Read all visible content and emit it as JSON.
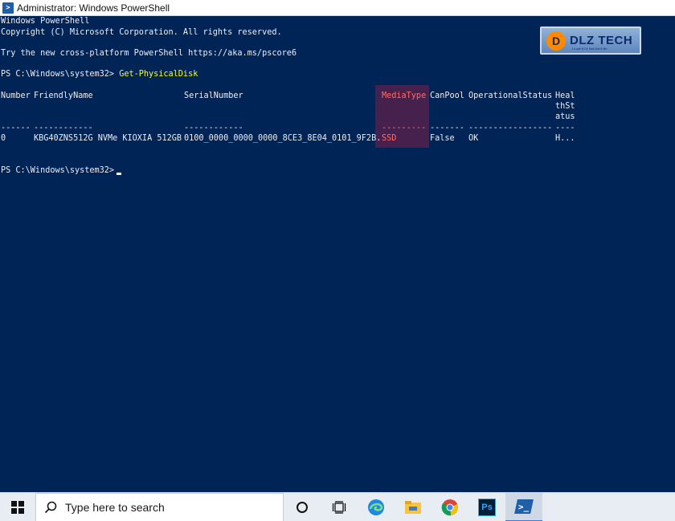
{
  "window": {
    "title": "Administrator: Windows PowerShell",
    "icon": "powershell-icon"
  },
  "console": {
    "banner_1": "Windows PowerShell",
    "banner_2": "Copyright (C) Microsoft Corporation. All rights reserved.",
    "banner_3": "Try the new cross-platform PowerShell https://aka.ms/pscore6",
    "prompt_1": "PS C:\\Windows\\system32> ",
    "command_1": "Get-PhysicalDisk",
    "prompt_2": "PS C:\\Windows\\system32> ",
    "table": {
      "headers": {
        "number": "Number",
        "friendly_name": "FriendlyName",
        "serial_number": "SerialNumber",
        "media_type": "MediaType",
        "can_pool": "CanPool",
        "operational_status": "OperationalStatus",
        "health_1": "Heal",
        "health_2": "thSt",
        "health_3": "atus"
      },
      "underlines": {
        "number": "------",
        "friendly_name": "------------",
        "serial_number": "------------",
        "media_type": "---------",
        "can_pool": "-------",
        "operational_status": "-----------------",
        "health": "----"
      },
      "row": {
        "number": "0",
        "friendly_name": "KBG40ZNS512G NVMe KIOXIA 512GB",
        "serial_number": "0100_0000_0000_0000_8CE3_8E04_0101_9F2B.",
        "media_type": "SSD",
        "can_pool": "False",
        "operational_status": "OK",
        "health": "H..."
      }
    },
    "highlight_color": "#c81e3c"
  },
  "watermark": {
    "brand": "DLZ TECH",
    "mark": "D",
    "tagline": "I Love It Or Not Don't Be"
  },
  "taskbar": {
    "search_placeholder": "Type here to search",
    "icons": [
      "windows-start-icon",
      "search-icon",
      "cortana-icon",
      "task-view-icon",
      "edge-icon",
      "file-explorer-icon",
      "chrome-icon",
      "photoshop-icon",
      "powershell-icon"
    ],
    "photoshop_label": "Ps"
  },
  "colors": {
    "console_bg": "#012456",
    "command_yellow": "#ffff00",
    "taskbar_bg": "#e8edf3"
  }
}
